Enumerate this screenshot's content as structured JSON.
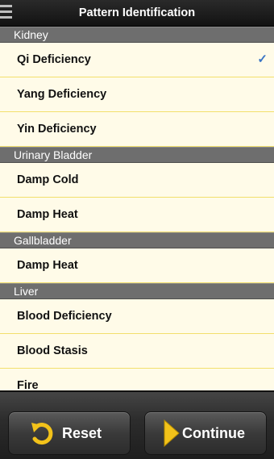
{
  "header": {
    "title": "Pattern Identification"
  },
  "sections": [
    {
      "title": "Kidney",
      "items": [
        {
          "label": "Qi Deficiency",
          "checked": true
        },
        {
          "label": "Yang Deficiency",
          "checked": false
        },
        {
          "label": "Yin Deficiency",
          "checked": false
        }
      ]
    },
    {
      "title": "Urinary Bladder",
      "items": [
        {
          "label": "Damp Cold",
          "checked": false
        },
        {
          "label": "Damp Heat",
          "checked": false
        }
      ]
    },
    {
      "title": "Gallbladder",
      "items": [
        {
          "label": "Damp Heat",
          "checked": false
        }
      ]
    },
    {
      "title": "Liver",
      "items": [
        {
          "label": "Blood Deficiency",
          "checked": false
        },
        {
          "label": "Blood Stasis",
          "checked": false
        },
        {
          "label": "Fire",
          "checked": false
        }
      ]
    }
  ],
  "check_glyph": "✓",
  "buttons": {
    "reset_label": "Reset",
    "continue_label": "Continue"
  },
  "colors": {
    "accent_yellow": "#f2c21a",
    "section_gray": "#6e6e6e",
    "row_bg": "#fffbe8",
    "check_blue": "#3a74c4"
  },
  "icons": {
    "menu": "menu-icon",
    "reset": "reset-icon",
    "continue": "play-icon"
  }
}
